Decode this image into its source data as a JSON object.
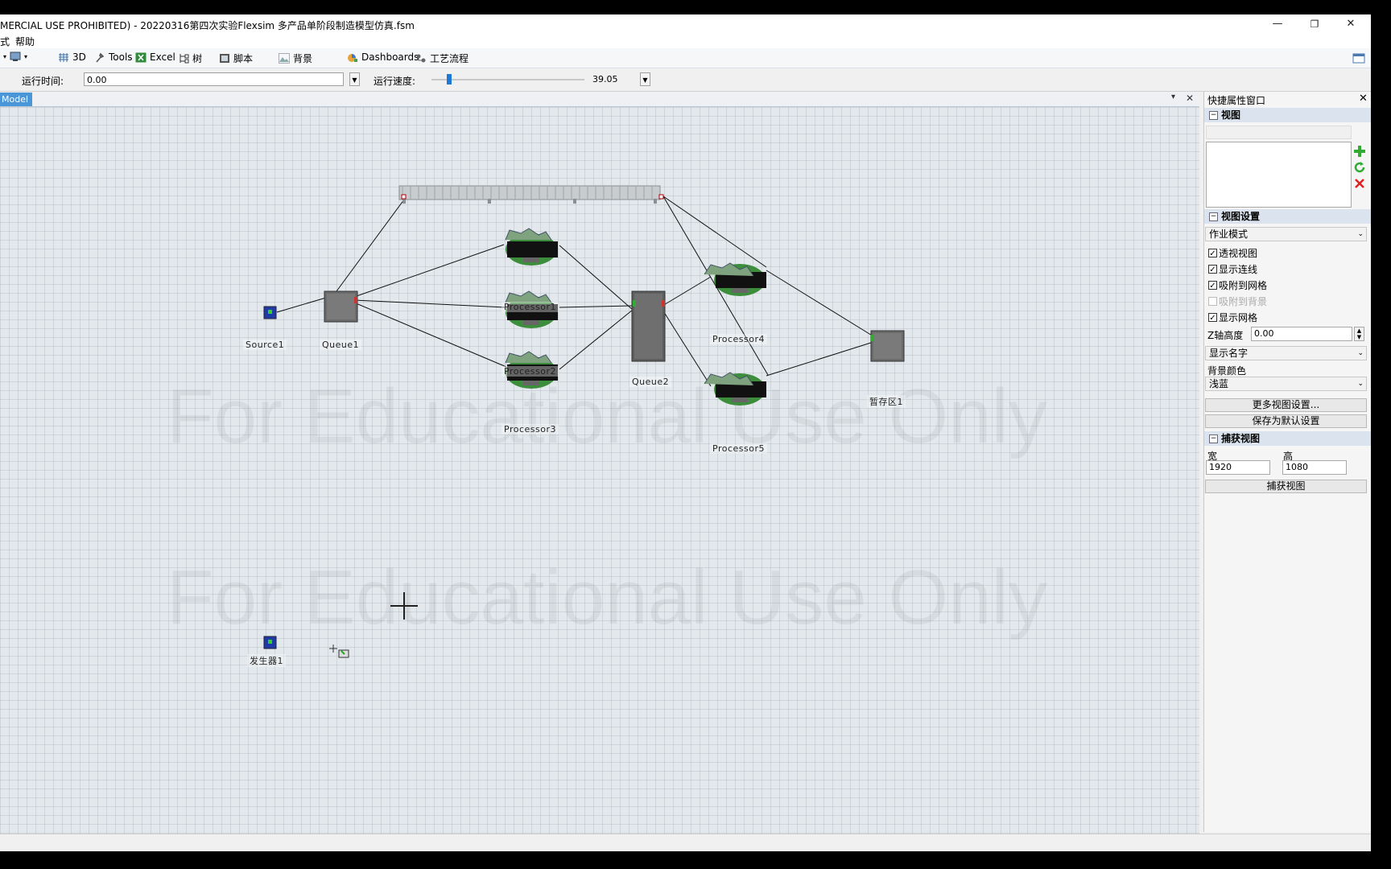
{
  "window": {
    "title": "MERCIAL USE PROHIBITED) - 20220316第四次实验Flexsim 多产品单阶段制造模型仿真.fsm",
    "minimize": "—",
    "restore": "❐",
    "close": "✕"
  },
  "menu": {
    "items": [
      "式",
      "帮助"
    ]
  },
  "toolbar": {
    "buttons": [
      {
        "label": "3D",
        "icon": "grid-3d-icon"
      },
      {
        "label": "Tools",
        "icon": "tools-icon"
      },
      {
        "label": "Excel",
        "icon": "excel-icon"
      },
      {
        "label": "树",
        "icon": "tree-icon"
      },
      {
        "label": "脚本",
        "icon": "script-icon"
      },
      {
        "label": "背景",
        "icon": "background-icon"
      },
      {
        "label": "Dashboards",
        "icon": "dashboards-icon"
      },
      {
        "label": "工艺流程",
        "icon": "process-flow-icon"
      }
    ]
  },
  "runbar": {
    "time_label": "运行时间:",
    "time_value": "0.00",
    "speed_label": "运行速度:",
    "speed_value": "39.05"
  },
  "doc": {
    "tab_label": "Model",
    "pin": "▾",
    "close": "✕"
  },
  "model": {
    "watermark": "For Educational Use Only",
    "objects": {
      "source1": "Source1",
      "queue1": "Queue1",
      "processor1": "Processor1",
      "processor2": "Processor2",
      "processor3": "Processor3",
      "queue2": "Queue2",
      "processor4": "Processor4",
      "processor5": "Processor5",
      "sink1": "暂存区1",
      "generator1": "发生器1"
    }
  },
  "panel": {
    "title": "快捷属性窗口",
    "close": "✕",
    "views_section": "视图",
    "view_settings_section": "视图设置",
    "mode_value": "作业模式",
    "checks": [
      {
        "label": "透视视图",
        "checked": true
      },
      {
        "label": "显示连线",
        "checked": true
      },
      {
        "label": "吸附到网格",
        "checked": true
      },
      {
        "label": "吸附到背景",
        "checked": false
      },
      {
        "label": "显示网格",
        "checked": true
      }
    ],
    "z_label": "Z轴高度",
    "z_value": "0.00",
    "names_value": "显示名字",
    "bg_color_label": "背景颜色",
    "bg_color_value": "浅蓝",
    "more_settings_button": "更多视图设置...",
    "save_default_button": "保存为默认设置",
    "capture_section": "捕获视图",
    "width_label": "宽",
    "height_label": "高",
    "width_value": "1920",
    "height_value": "1080",
    "capture_button": "捕获视图"
  }
}
